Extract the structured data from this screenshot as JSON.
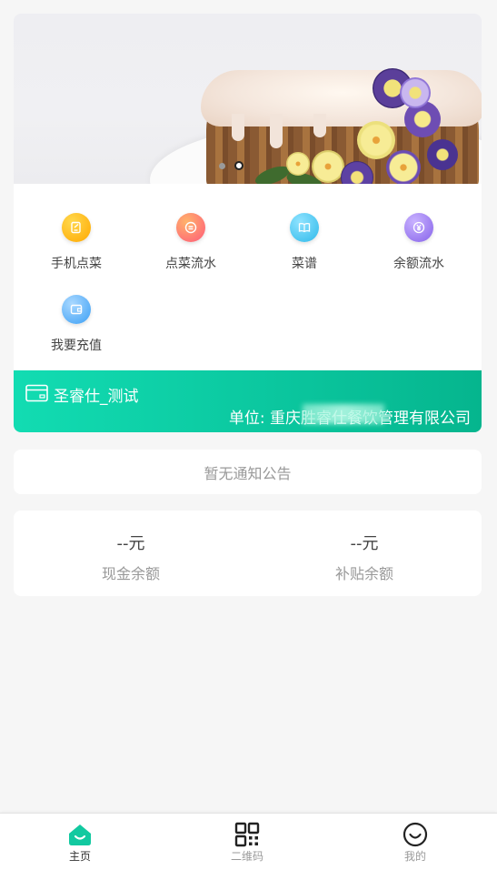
{
  "banner": {
    "image_alt": "",
    "slide_count": 2,
    "active_slide": 2
  },
  "menu": {
    "items": [
      {
        "label": "手机点菜",
        "icon": "order-icon",
        "color": "#ffb000"
      },
      {
        "label": "点菜流水",
        "icon": "order-record-icon",
        "color": "#ff6f6f"
      },
      {
        "label": "菜谱",
        "icon": "recipe-book-icon",
        "color": "#40c8ee"
      },
      {
        "label": "余额流水",
        "icon": "balance-record-icon",
        "color": "#9d7bf0"
      },
      {
        "label": "我要充值",
        "icon": "wallet-icon",
        "color": "#4aaef8"
      }
    ]
  },
  "card": {
    "name": "圣睿仕_测试",
    "unit": "单位: 重庆胜睿仕餐饮管理有限公司",
    "accent": "#0bc79f"
  },
  "notice": {
    "text": "暂无通知公告"
  },
  "balance": {
    "cash_value": "--元",
    "cash_label": "现金余额",
    "subsidy_value": "--元",
    "subsidy_label": "补贴余额"
  },
  "tabbar": {
    "tabs": [
      {
        "label": "主页",
        "icon": "home-icon",
        "active": true
      },
      {
        "label": "二维码",
        "icon": "qrcode-icon",
        "active": false
      },
      {
        "label": "我的",
        "icon": "smiley-user-icon",
        "active": false
      }
    ],
    "active_color": "#12c9a0"
  }
}
